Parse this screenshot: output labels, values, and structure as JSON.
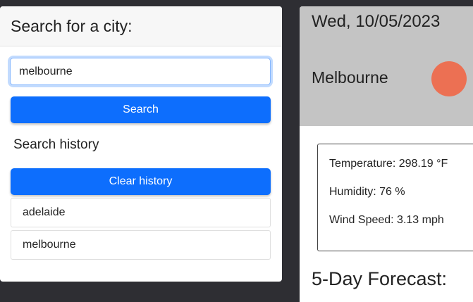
{
  "search": {
    "title": "Search for a city:",
    "input_value": "melbourne",
    "button_label": "Search"
  },
  "history": {
    "title": "Search history",
    "clear_label": "Clear history",
    "items": [
      {
        "label": "adelaide"
      },
      {
        "label": "melbourne"
      }
    ]
  },
  "weather": {
    "date": "Wed, 10/05/2023",
    "city": "Melbourne",
    "icon": "weather-condition-icon",
    "icon_color": "#ec7053",
    "temperature": "Temperature: 298.19 °F",
    "humidity": "Humidity: 76 %",
    "wind": "Wind Speed: 3.13 mph",
    "forecast_title": "5-Day Forecast:"
  },
  "colors": {
    "background": "#2e2e33",
    "primary": "#0d6efd",
    "weather_header": "#c4c4c4"
  }
}
